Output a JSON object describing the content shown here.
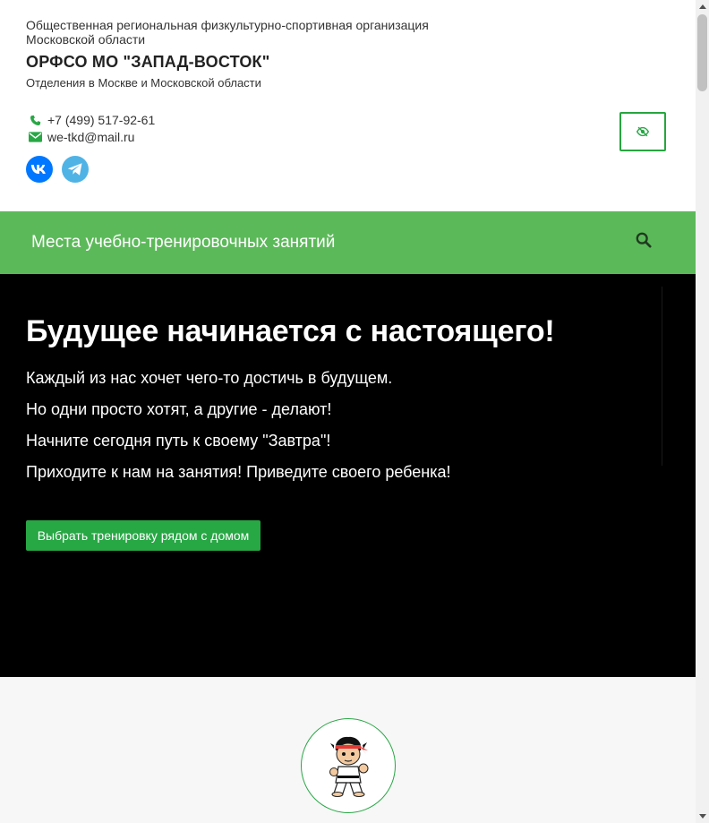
{
  "header": {
    "org_full": "Общественная региональная физкультурно-спортивная организация Московской области",
    "org_short": "ОРФСО МО \"ЗАПАД-ВОСТОК\"",
    "org_sub": "Отделения в Москве и Московской области",
    "phone": "+7 (499) 517-92-61",
    "email": "we-tkd@mail.ru"
  },
  "nav": {
    "link": "Места учебно-тренировочных занятий"
  },
  "hero": {
    "title": "Будущее начинается с настоящего!",
    "lines": [
      "Каждый из нас хочет чего-то достичь в будущем.",
      "Но одни просто хотят, а другие - делают!",
      "Начните сегодня путь к своему \"Завтра\"!",
      "Приходите к нам на занятия! Приведите своего ребенка!"
    ],
    "button": "Выбрать тренировку рядом с домом"
  },
  "colors": {
    "accent": "#28a745",
    "nav_bg": "#5cb95a",
    "hero_bg": "#000000",
    "vk": "#0077ff",
    "telegram": "#4fb3e6"
  },
  "icons": {
    "phone": "phone-icon",
    "email": "envelope-icon",
    "vk": "vk-icon",
    "telegram": "telegram-icon",
    "accessibility": "eye-slash-icon",
    "search": "search-icon"
  }
}
